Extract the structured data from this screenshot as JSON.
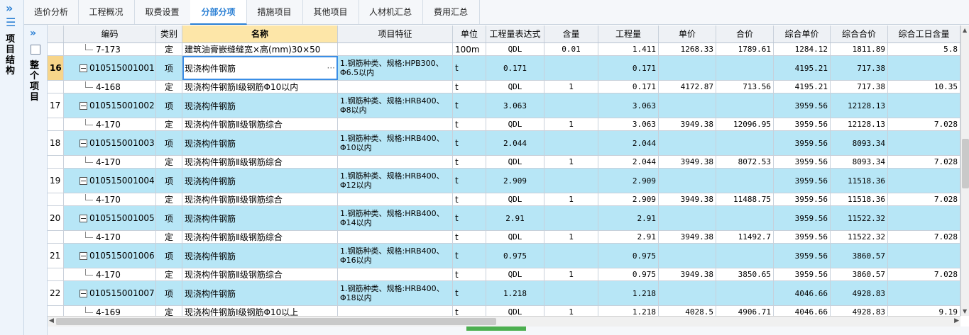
{
  "left_panel": {
    "chevron": "»",
    "menu": "☰",
    "label": "项目结构"
  },
  "side_panel": {
    "chevron": "»",
    "label": "整个项目"
  },
  "tabs": [
    {
      "label": "造价分析",
      "active": false
    },
    {
      "label": "工程概况",
      "active": false
    },
    {
      "label": "取费设置",
      "active": false
    },
    {
      "label": "分部分项",
      "active": true
    },
    {
      "label": "措施项目",
      "active": false
    },
    {
      "label": "其他项目",
      "active": false
    },
    {
      "label": "人材机汇总",
      "active": false
    },
    {
      "label": "费用汇总",
      "active": false
    }
  ],
  "columns": {
    "code": "编码",
    "type": "类别",
    "name": "名称",
    "feature": "项目特征",
    "unit": "单位",
    "expr": "工程量表达式",
    "content": "含量",
    "qty": "工程量",
    "price": "单价",
    "total": "合价",
    "comp_price": "综合单价",
    "comp_total": "综合合价",
    "labor": "综合工日含量"
  },
  "rows": [
    {
      "kind": "sub",
      "idx": "",
      "code": "7-173",
      "type": "定",
      "name": "建筑油膏嵌缝缝宽×高(mm)30×50",
      "feature": "",
      "unit": "100m",
      "expr": "QDL",
      "content": "0.01",
      "qty": "1.411",
      "price": "1268.33",
      "total": "1789.61",
      "comp_price": "1284.12",
      "comp_total": "1811.89",
      "labor": "5.8"
    },
    {
      "kind": "main",
      "idx": "16",
      "code": "010515001001",
      "type": "项",
      "name": "现浇构件钢筋",
      "feature": "1.钢筋种类、规格:HPB300、Φ6.5以内",
      "unit": "t",
      "expr": "0.171",
      "content": "",
      "qty": "0.171",
      "price": "",
      "total": "",
      "comp_price": "4195.21",
      "comp_total": "717.38",
      "labor": "",
      "selected": true
    },
    {
      "kind": "sub",
      "idx": "",
      "code": "4-168",
      "type": "定",
      "name": "现浇构件钢筋Ⅰ级钢筋Φ10以内",
      "feature": "",
      "unit": "t",
      "expr": "QDL",
      "content": "1",
      "qty": "0.171",
      "price": "4172.87",
      "total": "713.56",
      "comp_price": "4195.21",
      "comp_total": "717.38",
      "labor": "10.35"
    },
    {
      "kind": "main",
      "idx": "17",
      "code": "010515001002",
      "type": "项",
      "name": "现浇构件钢筋",
      "feature": "1.钢筋种类、规格:HRB400、Φ8以内",
      "unit": "t",
      "expr": "3.063",
      "content": "",
      "qty": "3.063",
      "price": "",
      "total": "",
      "comp_price": "3959.56",
      "comp_total": "12128.13",
      "labor": ""
    },
    {
      "kind": "sub",
      "idx": "",
      "code": "4-170",
      "type": "定",
      "name": "现浇构件钢筋Ⅱ级钢筋综合",
      "feature": "",
      "unit": "t",
      "expr": "QDL",
      "content": "1",
      "qty": "3.063",
      "price": "3949.38",
      "total": "12096.95",
      "comp_price": "3959.56",
      "comp_total": "12128.13",
      "labor": "7.028"
    },
    {
      "kind": "main",
      "idx": "18",
      "code": "010515001003",
      "type": "项",
      "name": "现浇构件钢筋",
      "feature": "1.钢筋种类、规格:HRB400、Φ10以内",
      "unit": "t",
      "expr": "2.044",
      "content": "",
      "qty": "2.044",
      "price": "",
      "total": "",
      "comp_price": "3959.56",
      "comp_total": "8093.34",
      "labor": ""
    },
    {
      "kind": "sub",
      "idx": "",
      "code": "4-170",
      "type": "定",
      "name": "现浇构件钢筋Ⅱ级钢筋综合",
      "feature": "",
      "unit": "t",
      "expr": "QDL",
      "content": "1",
      "qty": "2.044",
      "price": "3949.38",
      "total": "8072.53",
      "comp_price": "3959.56",
      "comp_total": "8093.34",
      "labor": "7.028"
    },
    {
      "kind": "main",
      "idx": "19",
      "code": "010515001004",
      "type": "项",
      "name": "现浇构件钢筋",
      "feature": "1.钢筋种类、规格:HRB400、Φ12以内",
      "unit": "t",
      "expr": "2.909",
      "content": "",
      "qty": "2.909",
      "price": "",
      "total": "",
      "comp_price": "3959.56",
      "comp_total": "11518.36",
      "labor": ""
    },
    {
      "kind": "sub",
      "idx": "",
      "code": "4-170",
      "type": "定",
      "name": "现浇构件钢筋Ⅱ级钢筋综合",
      "feature": "",
      "unit": "t",
      "expr": "QDL",
      "content": "1",
      "qty": "2.909",
      "price": "3949.38",
      "total": "11488.75",
      "comp_price": "3959.56",
      "comp_total": "11518.36",
      "labor": "7.028"
    },
    {
      "kind": "main",
      "idx": "20",
      "code": "010515001005",
      "type": "项",
      "name": "现浇构件钢筋",
      "feature": "1.钢筋种类、规格:HRB400、Φ14以内",
      "unit": "t",
      "expr": "2.91",
      "content": "",
      "qty": "2.91",
      "price": "",
      "total": "",
      "comp_price": "3959.56",
      "comp_total": "11522.32",
      "labor": ""
    },
    {
      "kind": "sub",
      "idx": "",
      "code": "4-170",
      "type": "定",
      "name": "现浇构件钢筋Ⅱ级钢筋综合",
      "feature": "",
      "unit": "t",
      "expr": "QDL",
      "content": "1",
      "qty": "2.91",
      "price": "3949.38",
      "total": "11492.7",
      "comp_price": "3959.56",
      "comp_total": "11522.32",
      "labor": "7.028"
    },
    {
      "kind": "main",
      "idx": "21",
      "code": "010515001006",
      "type": "项",
      "name": "现浇构件钢筋",
      "feature": "1.钢筋种类、规格:HRB400、Φ16以内",
      "unit": "t",
      "expr": "0.975",
      "content": "",
      "qty": "0.975",
      "price": "",
      "total": "",
      "comp_price": "3959.56",
      "comp_total": "3860.57",
      "labor": ""
    },
    {
      "kind": "sub",
      "idx": "",
      "code": "4-170",
      "type": "定",
      "name": "现浇构件钢筋Ⅱ级钢筋综合",
      "feature": "",
      "unit": "t",
      "expr": "QDL",
      "content": "1",
      "qty": "0.975",
      "price": "3949.38",
      "total": "3850.65",
      "comp_price": "3959.56",
      "comp_total": "3860.57",
      "labor": "7.028"
    },
    {
      "kind": "main",
      "idx": "22",
      "code": "010515001007",
      "type": "项",
      "name": "现浇构件钢筋",
      "feature": "1.钢筋种类、规格:HRB400、Φ18以内",
      "unit": "t",
      "expr": "1.218",
      "content": "",
      "qty": "1.218",
      "price": "",
      "total": "",
      "comp_price": "4046.66",
      "comp_total": "4928.83",
      "labor": ""
    },
    {
      "kind": "sub",
      "idx": "",
      "code": "4-169",
      "type": "定",
      "name": "现浇构件钢筋Ⅰ级钢筋Φ10以上",
      "feature": "",
      "unit": "t",
      "expr": "QDL",
      "content": "1",
      "qty": "1.218",
      "price": "4028.5",
      "total": "4906.71",
      "comp_price": "4046.66",
      "comp_total": "4928.83",
      "labor": "9.19"
    }
  ],
  "selected_cell_more": "···",
  "colors": {
    "accent": "#2a7fd4",
    "main_row": "#b7e6f6",
    "name_header": "#fde6a8",
    "selected_index": "#f7d58a"
  }
}
